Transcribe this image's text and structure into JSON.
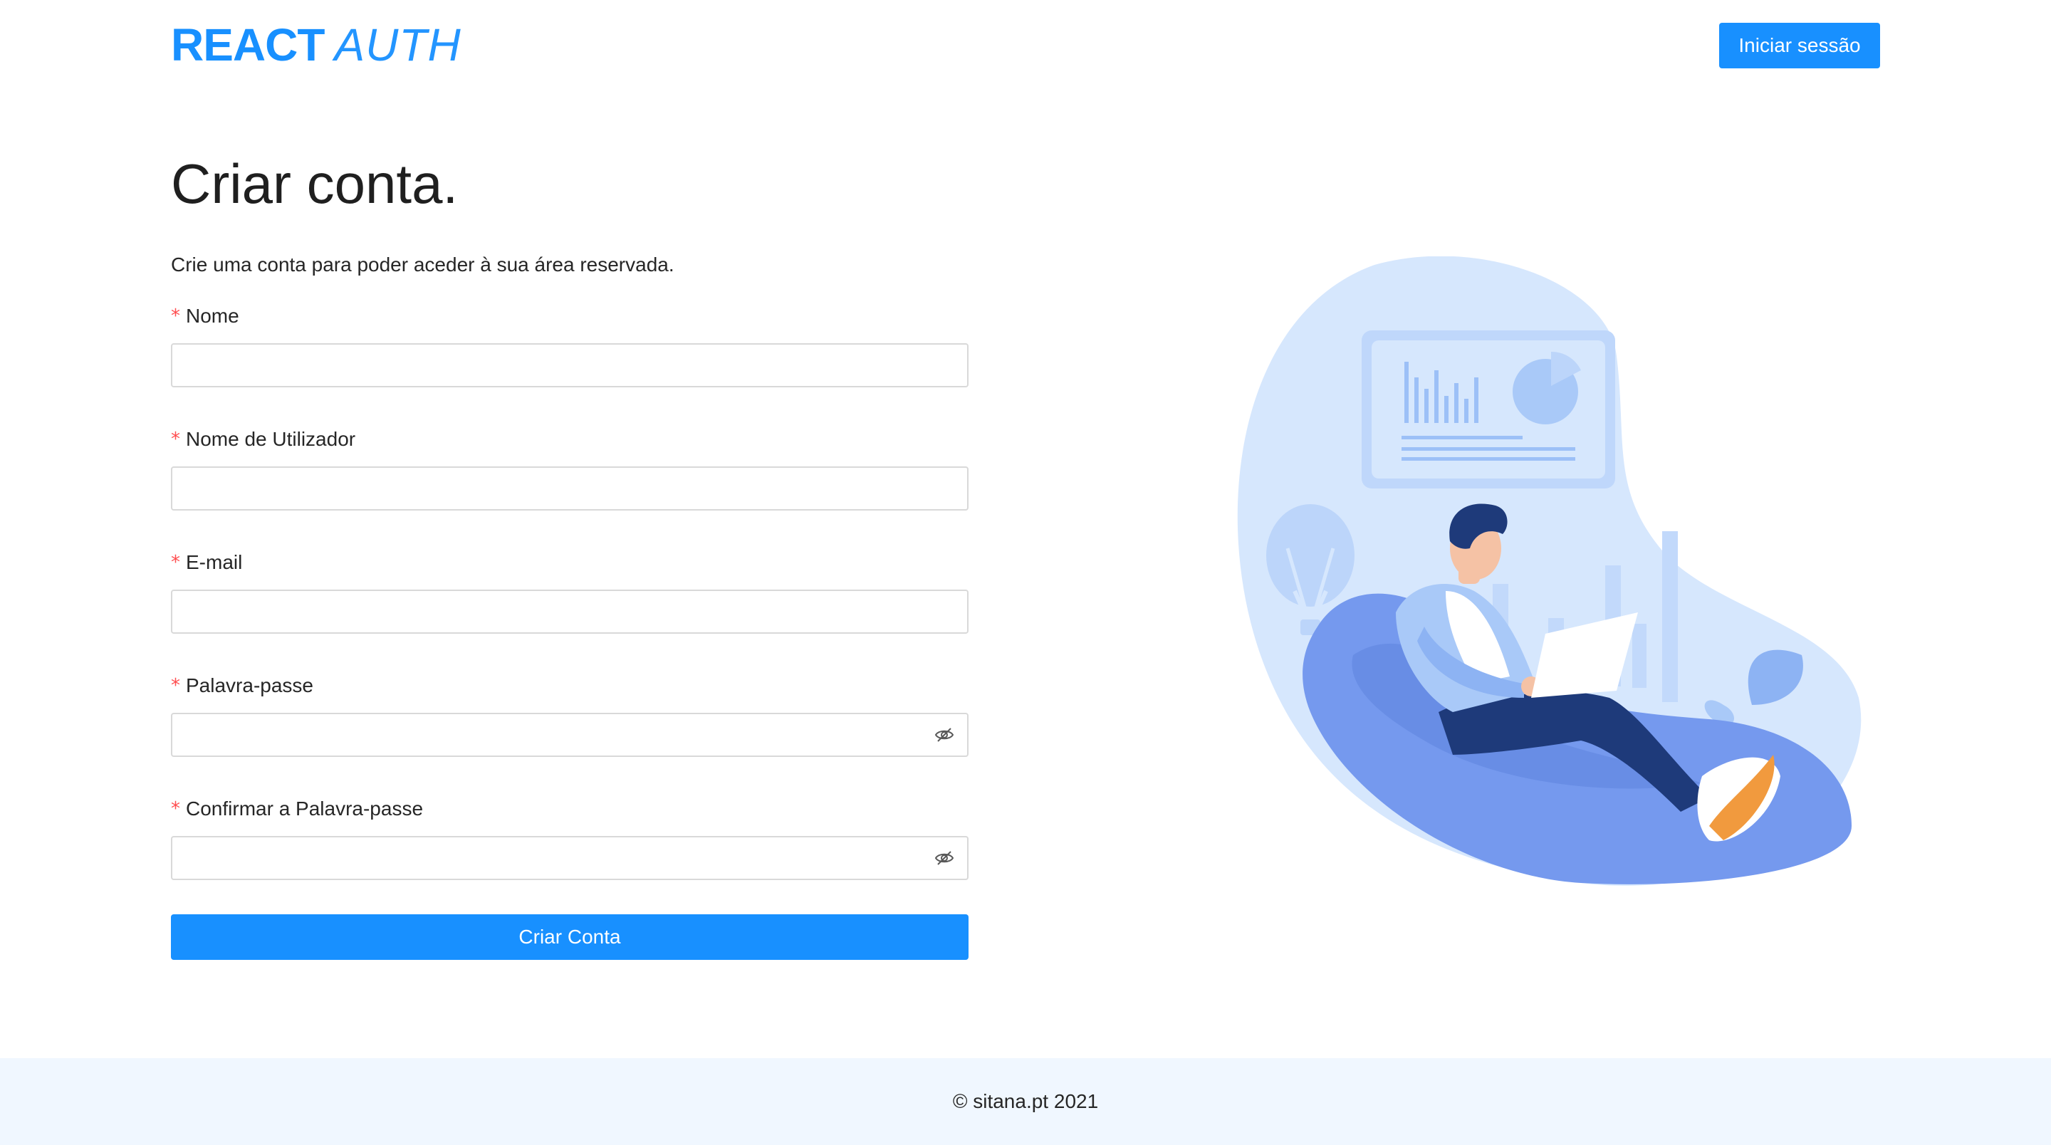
{
  "header": {
    "logo_bold": "REACT",
    "logo_light": "AUTH",
    "login_button": "Iniciar sessão"
  },
  "main": {
    "title": "Criar conta.",
    "subtitle": "Crie uma conta para poder aceder à sua área reservada.",
    "required_mark": "*",
    "fields": [
      {
        "label": "Nome",
        "value": "",
        "type": "text"
      },
      {
        "label": "Nome de Utilizador",
        "value": "",
        "type": "text"
      },
      {
        "label": "E-mail",
        "value": "",
        "type": "email"
      },
      {
        "label": "Palavra-passe",
        "value": "",
        "type": "password",
        "icon": "eye-invisible-icon"
      },
      {
        "label": "Confirmar a Palavra-passe",
        "value": "",
        "type": "password",
        "icon": "eye-invisible-icon"
      }
    ],
    "submit_button": "Criar Conta"
  },
  "footer": {
    "text": "© sitana.pt 2021"
  },
  "colors": {
    "primary": "#1890ff",
    "required": "#ff4d4f",
    "footer_bg": "#f0f7ff",
    "illustration_blob": "#d6e7fd",
    "illustration_seat": "#7599ee",
    "illustration_pants": "#1e3a7a"
  }
}
